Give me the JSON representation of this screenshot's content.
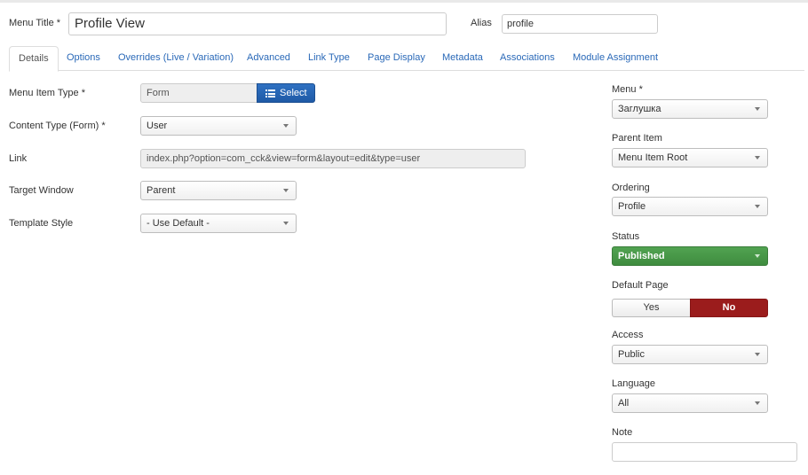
{
  "title_row": {
    "menu_title_label": "Menu Title *",
    "menu_title_value": "Profile View",
    "alias_label": "Alias",
    "alias_value": "profile"
  },
  "tabs": [
    {
      "label": "Details",
      "active": true
    },
    {
      "label": "Options"
    },
    {
      "label": "Overrides (Live / Variation)"
    },
    {
      "label": "Advanced"
    },
    {
      "label": "Link Type"
    },
    {
      "label": "Page Display"
    },
    {
      "label": "Metadata"
    },
    {
      "label": "Associations"
    },
    {
      "label": "Module Assignment"
    }
  ],
  "details": {
    "menu_item_type": {
      "label": "Menu Item Type *",
      "value": "Form",
      "button": "Select",
      "button_icon": "list-icon"
    },
    "content_type": {
      "label": "Content Type (Form) *",
      "value": "User"
    },
    "link": {
      "label": "Link",
      "value": "index.php?option=com_cck&view=form&layout=edit&type=user"
    },
    "target_window": {
      "label": "Target Window",
      "value": "Parent"
    },
    "template_style": {
      "label": "Template Style",
      "value": "- Use Default -"
    }
  },
  "sidebar": {
    "menu": {
      "label": "Menu *",
      "value": "Заглушка"
    },
    "parent_item": {
      "label": "Parent Item",
      "value": "Menu Item Root"
    },
    "ordering": {
      "label": "Ordering",
      "value": "Profile"
    },
    "status": {
      "label": "Status",
      "value": "Published",
      "color": "#46994a"
    },
    "default_page": {
      "label": "Default Page",
      "yes": "Yes",
      "no": "No",
      "selected": "No",
      "no_color": "#9b1c1c"
    },
    "access": {
      "label": "Access",
      "value": "Public"
    },
    "language": {
      "label": "Language",
      "value": "All"
    },
    "note": {
      "label": "Note",
      "value": ""
    }
  },
  "colors": {
    "link": "#2a69b8",
    "select_button": "#2a69b8"
  }
}
